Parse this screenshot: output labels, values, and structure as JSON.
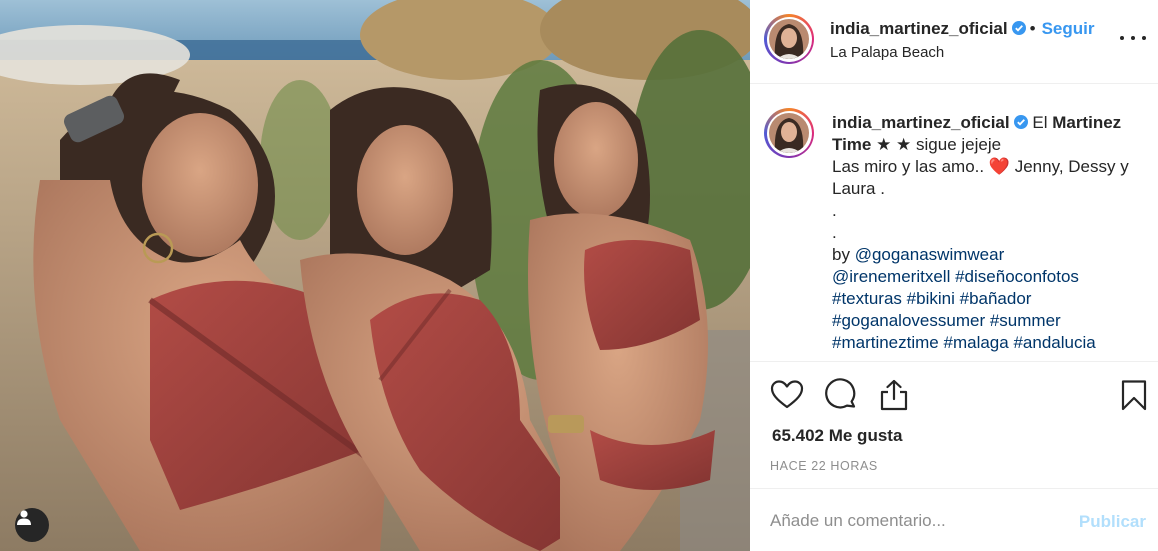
{
  "post": {
    "username": "india_martinez_oficial",
    "separator": "•",
    "follow_label": "Seguir",
    "location": "La Palapa Beach",
    "more_icon": "more-options-icon"
  },
  "caption": {
    "username": "india_martinez_oficial",
    "line1_a": "El ",
    "line1_b": "Martinez Time",
    "line1_c": " ★ ★ sigue jejeje",
    "line2_a": "Las miro y las amo.. ",
    "heart": "❤️",
    "line2_b": " Jenny, Dessy y Laura .",
    "dot1": ".",
    "dot2": ".",
    "by": "by ",
    "mention1": "@goganaswimwear",
    "mention2": "@irenemeritxell",
    "tag1": "#diseñoconfotos",
    "tag2": "#texturas",
    "tag3": "#bikini",
    "tag4": "#bañador",
    "tag5": "#goganalovessumer",
    "tag6": "#summer",
    "tag7": "#martineztime",
    "tag8": "#malaga",
    "tag9": "#andalucia"
  },
  "actions": {
    "likes": "65.402 Me gusta",
    "timestamp": "HACE 22 HORAS"
  },
  "comment": {
    "placeholder": "Añade un comentario...",
    "publish_label": "Publicar"
  },
  "colors": {
    "accent": "#3897f0",
    "publish_disabled": "#b2dffc",
    "hashtag": "#003569",
    "swimsuit": "#a8433f"
  }
}
